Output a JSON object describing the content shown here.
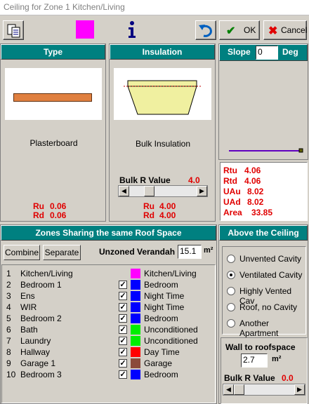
{
  "window": {
    "title": "Ceiling for Zone 1  Kitchen/Living"
  },
  "toolbar": {
    "ok_label": "OK",
    "cancel_label": "Cancel",
    "color_swatch": "#ff00ff"
  },
  "type_panel": {
    "header": "Type",
    "material": "Plasterboard",
    "ru_label": "Ru",
    "ru_value": "0.06",
    "rd_label": "Rd",
    "rd_value": "0.06"
  },
  "insulation_panel": {
    "header": "Insulation",
    "material": "Bulk Insulation",
    "bulk_r_label": "Bulk R Value",
    "bulk_r_value": "4.0",
    "ru_label": "Ru",
    "ru_value": "4.00",
    "rd_label": "Rd",
    "rd_value": "4.00"
  },
  "slope_panel": {
    "label": "Slope",
    "value": "0",
    "unit": "Deg"
  },
  "results": {
    "rtu_label": "Rtu",
    "rtu_value": "4.06",
    "rtd_label": "Rtd",
    "rtd_value": "4.06",
    "uau_label": "UAu",
    "uau_value": "8.02",
    "uad_label": "UAd",
    "uad_value": "8.02",
    "area_label": "Area",
    "area_value": "33.85"
  },
  "zones_panel": {
    "header": "Zones Sharing the same Roof Space",
    "combine_label": "Combine",
    "separate_label": "Separate",
    "unzoned_label": "Unzoned Verandah",
    "unzoned_value": "15.1",
    "unit": "m²",
    "rows": [
      {
        "num": "1",
        "name": "Kitchen/Living",
        "checkbox": false,
        "checked": false,
        "color": "#ff00ff",
        "type": "Kitchen/Living"
      },
      {
        "num": "2",
        "name": "Bedroom 1",
        "checkbox": true,
        "checked": true,
        "color": "#0000ff",
        "type": "Bedroom"
      },
      {
        "num": "3",
        "name": "Ens",
        "checkbox": true,
        "checked": true,
        "color": "#0000ff",
        "type": "Night Time"
      },
      {
        "num": "4",
        "name": "WIR",
        "checkbox": true,
        "checked": true,
        "color": "#0000ff",
        "type": "Night Time"
      },
      {
        "num": "5",
        "name": "Bedroom 2",
        "checkbox": true,
        "checked": true,
        "color": "#0000ff",
        "type": "Bedroom"
      },
      {
        "num": "6",
        "name": "Bath",
        "checkbox": true,
        "checked": true,
        "color": "#00ee00",
        "type": "Unconditioned"
      },
      {
        "num": "7",
        "name": "Laundry",
        "checkbox": true,
        "checked": true,
        "color": "#00ee00",
        "type": "Unconditioned"
      },
      {
        "num": "8",
        "name": "Hallway",
        "checkbox": true,
        "checked": true,
        "color": "#ff0000",
        "type": "Day Time"
      },
      {
        "num": "9",
        "name": "Garage 1",
        "checkbox": true,
        "checked": true,
        "color": "#8b4a3a",
        "type": "Garage"
      },
      {
        "num": "10",
        "name": "Bedroom 3",
        "checkbox": true,
        "checked": true,
        "color": "#0000ff",
        "type": "Bedroom"
      }
    ]
  },
  "above_panel": {
    "header": "Above the Ceiling",
    "options": [
      {
        "label": "Unvented Cavity",
        "selected": false
      },
      {
        "label": "Ventilated Cavity",
        "selected": true
      },
      {
        "label": "Highly Vented Cav",
        "selected": false
      },
      {
        "label": "Roof, no Cavity",
        "selected": false
      },
      {
        "label": "Another Apartment",
        "selected": false
      }
    ],
    "wall_label": "Wall to roofspace",
    "wall_value": "2.7",
    "unit": "m²",
    "bulk_r_label": "Bulk R Value",
    "bulk_r_value": "0.0"
  }
}
